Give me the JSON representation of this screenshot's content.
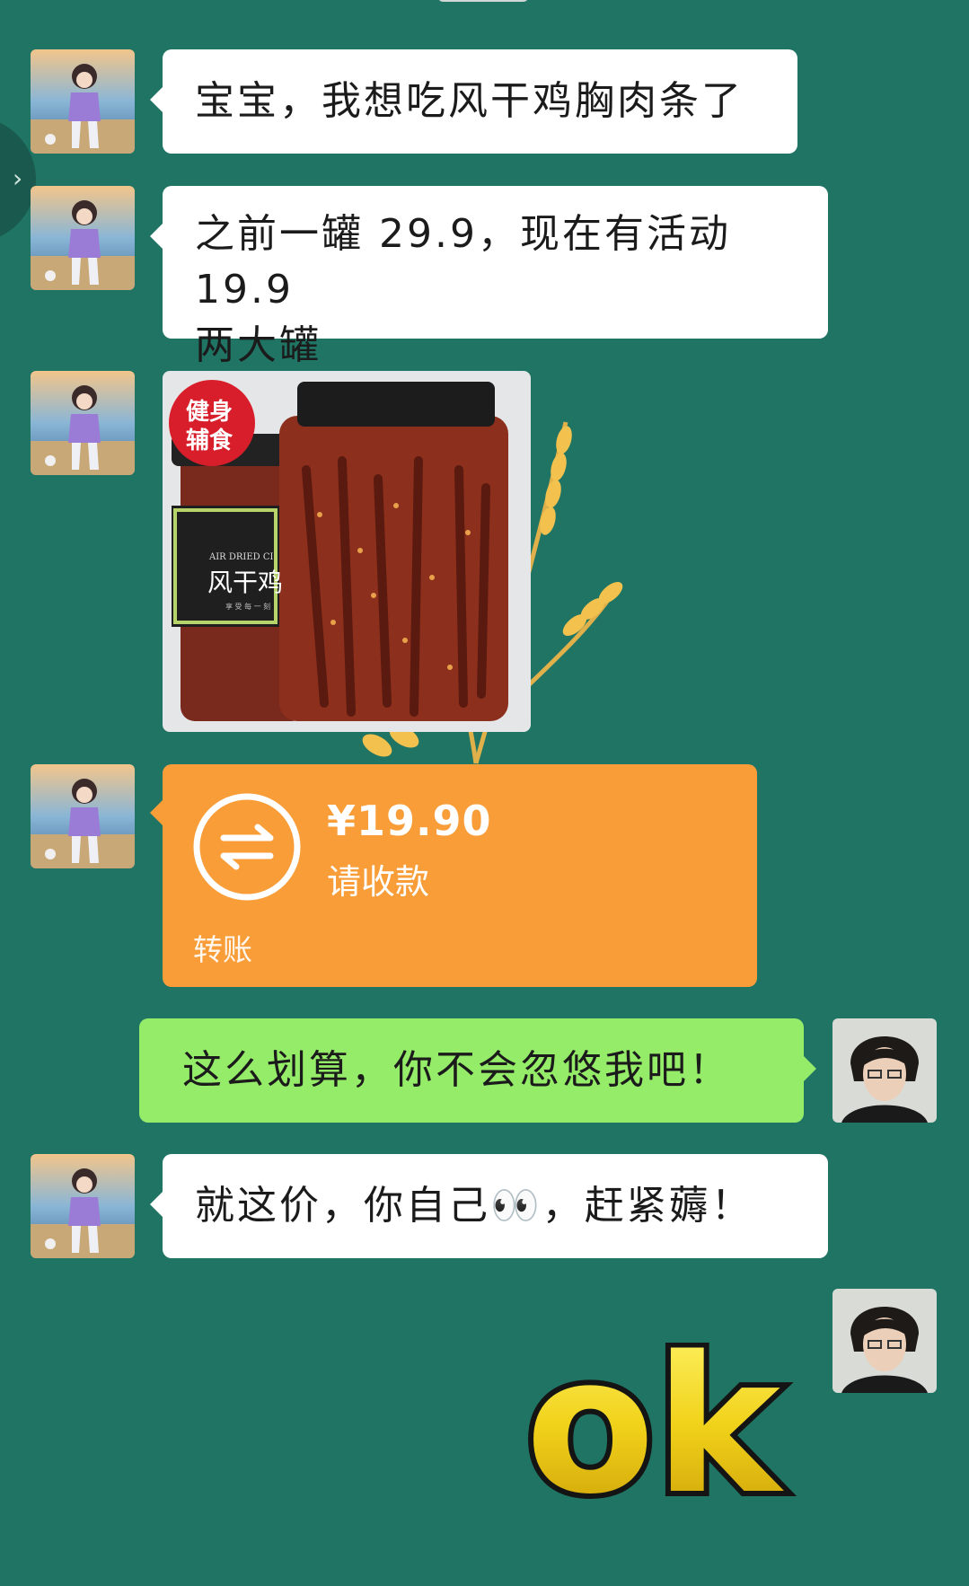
{
  "chat": {
    "messages": [
      {
        "sender": "contact",
        "text": "宝宝，我想吃风干鸡胸肉条了"
      },
      {
        "sender": "contact",
        "text_line1": "之前一罐 29.9，现在有活动 19.9",
        "text_line2": "两大罐"
      },
      {
        "sender": "contact",
        "type": "image",
        "badge": "健身辅食",
        "badge_line1": "健身",
        "badge_line2": "辅食",
        "label_en": "AIR DRIED CI",
        "label_cn": "风干鸡",
        "label_small": "享 受 每 一 刻"
      },
      {
        "sender": "contact",
        "type": "transfer",
        "amount": "¥19.90",
        "status": "请收款",
        "label": "转账"
      },
      {
        "sender": "me",
        "text": "这么划算，你不会忽悠我吧！"
      },
      {
        "sender": "contact",
        "text_before": "就这价，你自己",
        "emoji": "👀",
        "text_after": "，赶紧薅！"
      },
      {
        "sender": "me",
        "type": "sticker",
        "sticker_text": "ok"
      }
    ]
  },
  "colors": {
    "background": "#1f7464",
    "bubble_received": "#ffffff",
    "bubble_sent": "#95ec69",
    "transfer": "#f89d38"
  },
  "icons": {
    "transfer": "transfer-arrows-icon",
    "nav": "chevron-right-icon"
  }
}
